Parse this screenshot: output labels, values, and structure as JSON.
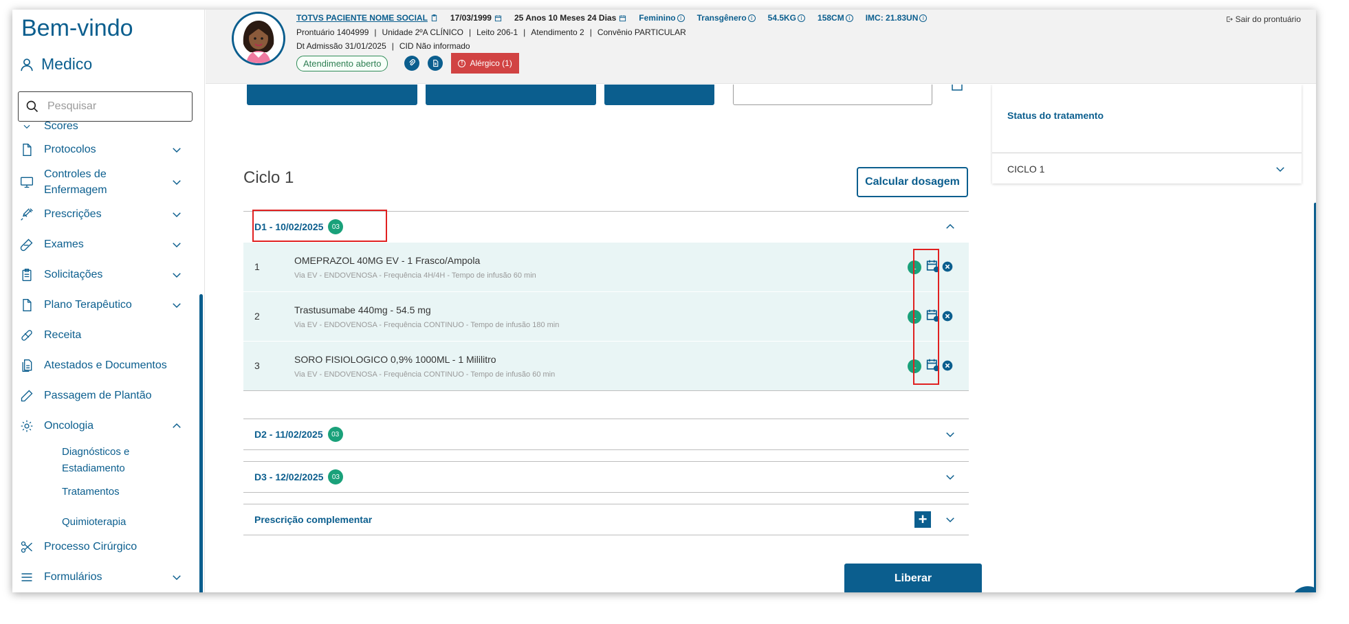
{
  "sidebar": {
    "welcome": "Bem-vindo",
    "user": "Medico",
    "search_placeholder": "Pesquisar",
    "items": [
      {
        "label": "Scores"
      },
      {
        "label": "Protocolos"
      },
      {
        "label": "Controles de Enfermagem"
      },
      {
        "label": "Prescrições"
      },
      {
        "label": "Exames"
      },
      {
        "label": "Solicitações"
      },
      {
        "label": "Plano Terapêutico"
      },
      {
        "label": "Receita"
      },
      {
        "label": "Atestados e Documentos"
      },
      {
        "label": "Passagem de Plantão"
      },
      {
        "label": "Oncologia"
      },
      {
        "label": "Processo Cirúrgico"
      },
      {
        "label": "Formulários"
      }
    ],
    "oncologia_sub": [
      "Diagnósticos e Estadiamento",
      "Tratamentos",
      "Quimioterapia"
    ]
  },
  "header": {
    "patient_name": "TOTVS PACIENTE NOME SOCIAL",
    "birth_date": "17/03/1999",
    "age": "25 Anos 10 Meses 24 Dias",
    "gender": "Feminino",
    "identity": "Transgênero",
    "weight": "54.5KG",
    "height": "158CM",
    "imc": "IMC: 21.83UN",
    "prontuario": "Prontuário 1404999",
    "unidade": "Unidade 2ºA CLÍNICO",
    "leito": "Leito 206-1",
    "atendimento": "Atendimento 2",
    "convenio": "Convênio PARTICULAR",
    "admissao": "Dt Admissão 31/01/2025",
    "cid": "CID Não informado",
    "status_badge": "Atendimento aberto",
    "allergy": "Alérgico (1)",
    "exit": "Sair do prontuário"
  },
  "main": {
    "ciclo_title": "Ciclo 1",
    "calc_button": "Calcular dosagem",
    "days": [
      {
        "label": "D1 - 10/02/2025",
        "count": "03",
        "items": [
          {
            "num": "1",
            "drug": "OMEPRAZOL 40MG EV - 1 Frasco/Ampola",
            "detail": "Via EV - ENDOVENOSA - Frequência 4H/4H - Tempo de infusão 60 min",
            "badge": "L"
          },
          {
            "num": "2",
            "drug": "Trastusumabe 440mg - 54.5 mg",
            "detail": "Via EV - ENDOVENOSA - Frequência CONTINUO - Tempo de infusão 180 min",
            "badge": "L"
          },
          {
            "num": "3",
            "drug": "SORO FISIOLOGICO 0,9% 1000ML - 1 Mililitro",
            "detail": "Via EV - ENDOVENOSA - Frequência CONTINUO - Tempo de infusão 60 min",
            "badge": "L"
          }
        ]
      },
      {
        "label": "D2 - 11/02/2025",
        "count": "03"
      },
      {
        "label": "D3 - 12/02/2025",
        "count": "03"
      }
    ],
    "complementar": "Prescrição complementar",
    "liberar": "Liberar"
  },
  "status_panel": {
    "title": "Status do tratamento",
    "ciclo": "CICLO 1"
  },
  "colors": {
    "primary": "#0b5e8e",
    "badge_green": "#1aa17a",
    "allergy_red": "#d14343",
    "highlight_red": "#e02020"
  }
}
